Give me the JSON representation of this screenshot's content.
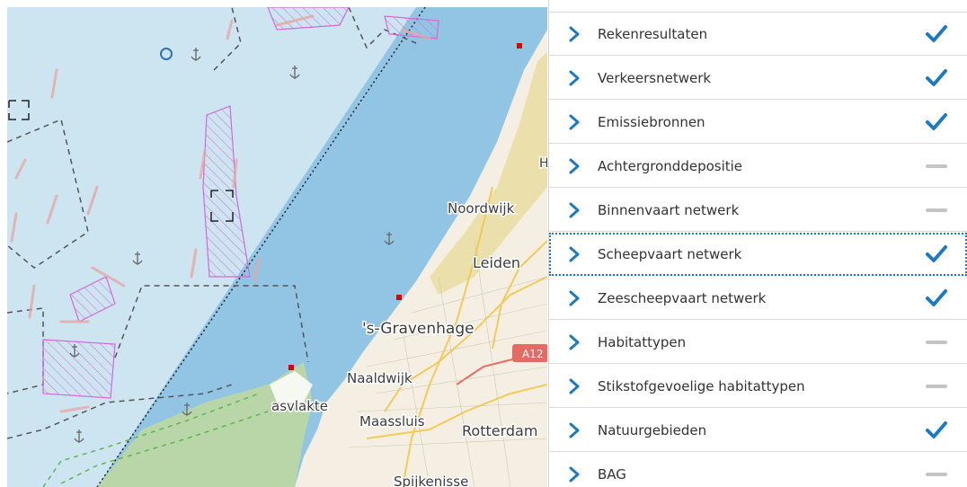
{
  "colors": {
    "accent": "#1c7ac3",
    "sea": "#cde4f1",
    "channel": "#92c5e4",
    "land": "#f4efe2",
    "nature": "#b8d6a8",
    "hatch": "#d36ad8",
    "state_off": "#c4c4c4"
  },
  "map": {
    "labels": {
      "noordwijk": "Noordwijk",
      "leiden": "Leiden",
      "gravenhage": "'s-Gravenhage",
      "naaldwijk": "Naaldwijk",
      "maasvlakte": "asvlakte",
      "maassluis": "Maassluis",
      "rotterdam": "Rotterdam",
      "spijkenisse": "Spijkenisse",
      "a12": "A12",
      "h_edge": "H"
    }
  },
  "layers": [
    {
      "label": "Rekenresultaten",
      "active": true,
      "state_icon": "checkmark-icon"
    },
    {
      "label": "Verkeersnetwerk",
      "active": true,
      "state_icon": "checkmark-icon"
    },
    {
      "label": "Emissiebronnen",
      "active": true,
      "state_icon": "checkmark-icon"
    },
    {
      "label": "Achtergronddepositie",
      "active": false,
      "state_icon": "dash-icon"
    },
    {
      "label": "Binnenvaart netwerk",
      "active": false,
      "state_icon": "dash-icon"
    },
    {
      "label": "Scheepvaart netwerk",
      "active": true,
      "state_icon": "checkmark-icon",
      "focused": true
    },
    {
      "label": "Zeescheepvaart netwerk",
      "active": true,
      "state_icon": "checkmark-icon"
    },
    {
      "label": "Habitattypen",
      "active": false,
      "state_icon": "dash-icon"
    },
    {
      "label": "Stikstofgevoelige habitattypen",
      "active": false,
      "state_icon": "dash-icon"
    },
    {
      "label": "Natuurgebieden",
      "active": true,
      "state_icon": "checkmark-icon"
    },
    {
      "label": "BAG",
      "active": false,
      "state_icon": "dash-icon"
    }
  ]
}
